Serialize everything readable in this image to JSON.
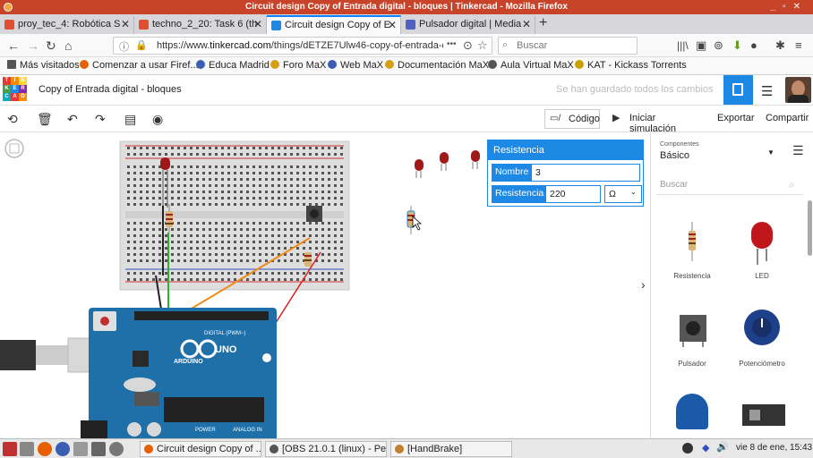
{
  "window": {
    "title": "Circuit design Copy of Entrada digital - bloques | Tinkercad - Mozilla Firefox"
  },
  "tabs": [
    {
      "label": "proy_tec_4: Robótica S",
      "color": "#e05030"
    },
    {
      "label": "techno_2_20: Task 6 (th",
      "color": "#e05030"
    },
    {
      "label": "Circuit design Copy of E",
      "color": "#1e88e5"
    },
    {
      "label": "Pulsador digital | Media",
      "color": "#5060c0"
    }
  ],
  "nav": {
    "url_prefix": "https://www.",
    "url_domain": "tinkercad.com",
    "url_path": "/things/dETZE7Ulw46-copy-of-entrada-dig",
    "url_more": "•••",
    "search_placeholder": "Buscar"
  },
  "bookmarks": [
    {
      "label": "Más visitados",
      "color": "#555"
    },
    {
      "label": "Comenzar a usar Firef...",
      "color": "#e66000"
    },
    {
      "label": "Educa Madrid",
      "color": "#3a5fb0"
    },
    {
      "label": "Foro MaX",
      "color": "#d4a017"
    },
    {
      "label": "Web MaX",
      "color": "#3a5fb0"
    },
    {
      "label": "Documentación MaX",
      "color": "#d4a017"
    },
    {
      "label": "Aula Virtual MaX",
      "color": "#555"
    },
    {
      "label": "KAT - Kickass Torrents",
      "color": "#c9a000"
    }
  ],
  "tinkercad": {
    "logo": [
      "TIN",
      "KER",
      "CAD"
    ],
    "doc_title": "Copy of Entrada digital - bloques",
    "saved_msg": "Se han guardado todos los cambios"
  },
  "toolbar": {
    "code_label": "Código",
    "sim_label": "Iniciar simulación",
    "export_label": "Exportar",
    "share_label": "Compartir"
  },
  "props": {
    "header": "Resistencia",
    "name_label": "Nombre",
    "name_value": "3",
    "res_label": "Resistencia",
    "res_value": "220",
    "unit": "Ω"
  },
  "panel": {
    "components_caption": "Componentes",
    "components_value": "Básico",
    "search_placeholder": "Buscar",
    "items": [
      "Resistencia",
      "LED",
      "Pulsador",
      "Potenciómetro"
    ]
  },
  "arduino": {
    "brand": "ARDUINO",
    "model": "UNO",
    "digital": "DIGITAL (PWM~)",
    "power": "POWER",
    "analog": "ANALOG IN"
  },
  "taskbar": {
    "tasks": [
      "Circuit design Copy of ...",
      "[OBS 21.0.1 (linux) - Pe...",
      "[HandBrake]"
    ],
    "clock": "vie 8 de ene, 15:43"
  }
}
